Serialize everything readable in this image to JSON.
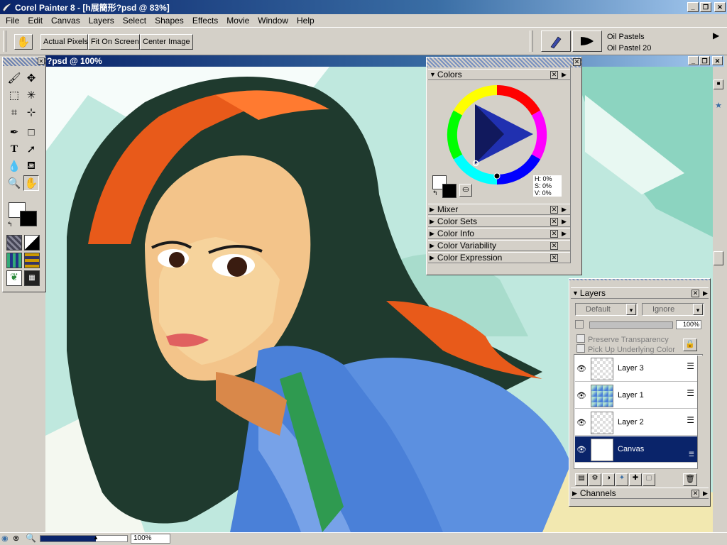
{
  "app": {
    "title": "Corel Painter 8 - [h展簡形?psd @ 83%]",
    "window_buttons": [
      "_",
      "❐",
      "✕"
    ]
  },
  "menu": [
    "File",
    "Edit",
    "Canvas",
    "Layers",
    "Select",
    "Shapes",
    "Effects",
    "Movie",
    "Window",
    "Help"
  ],
  "property_bar": {
    "actual_pixels": "Actual Pixels",
    "fit_on_screen": "Fit On Screen",
    "center_image": "Center Image",
    "brush_category": "Oil Pastels",
    "brush_variant": "Oil Pastel 20"
  },
  "document": {
    "title": "?psd @ 100%"
  },
  "colors_palette": {
    "title": "Colors",
    "readout": [
      "H: 0%",
      "S: 0%",
      "V: 0%"
    ],
    "sections": [
      "Mixer",
      "Color Sets",
      "Color Info",
      "Color Variability",
      "Color Expression"
    ]
  },
  "layers_palette": {
    "title": "Layers",
    "composite_method": "Default",
    "depth_method": "Ignore",
    "opacity": "100%",
    "preserve_transparency": "Preserve Transparency",
    "pick_up_underlying": "Pick Up Underlying Color",
    "layers": [
      {
        "name": "Layer 3",
        "selected": false
      },
      {
        "name": "Layer 1",
        "selected": false
      },
      {
        "name": "Layer 2",
        "selected": false
      },
      {
        "name": "Canvas",
        "selected": true
      }
    ],
    "channels": "Channels"
  },
  "status": {
    "zoom": "100%"
  },
  "colors": {
    "selection": "#0a246a",
    "face": "#d4d0c8",
    "canvas_bg": "#bfe8de"
  }
}
